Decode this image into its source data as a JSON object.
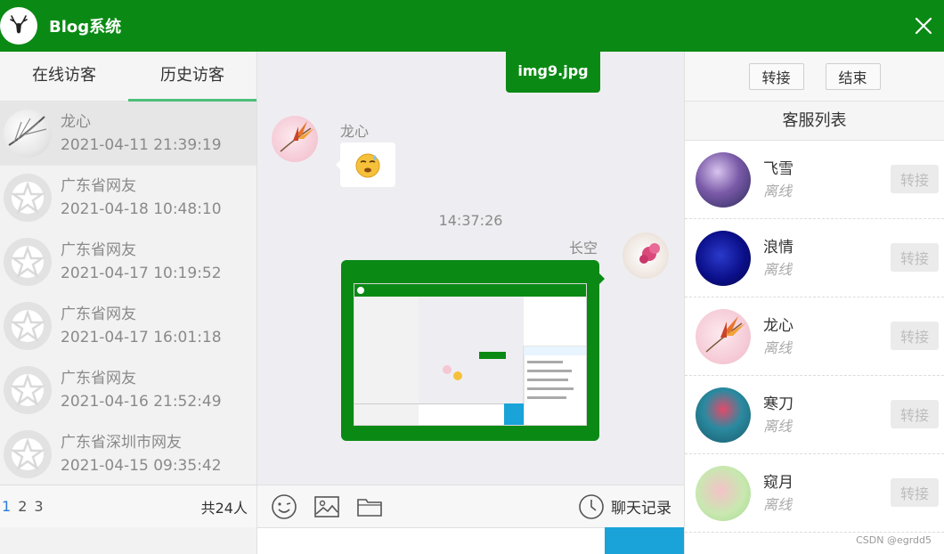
{
  "app": {
    "title": "Blog系统"
  },
  "left_panel": {
    "tabs": [
      {
        "label": "在线访客",
        "active": false
      },
      {
        "label": "历史访客",
        "active": true
      }
    ],
    "visitors": [
      {
        "name": "龙心",
        "time": "2021-04-11 21:39:19",
        "avatar": "feather-avatar",
        "selected": true
      },
      {
        "name": "广东省网友",
        "time": "2021-04-18 10:48:10",
        "avatar": "guest-avatar"
      },
      {
        "name": "广东省网友",
        "time": "2021-04-17 10:19:52",
        "avatar": "guest-avatar"
      },
      {
        "name": "广东省网友",
        "time": "2021-04-17 16:01:18",
        "avatar": "guest-avatar"
      },
      {
        "name": "广东省网友",
        "time": "2021-04-16 21:52:49",
        "avatar": "guest-avatar"
      },
      {
        "name": "广东省深圳市网友",
        "time": "2021-04-15 09:35:42",
        "avatar": "guest-avatar"
      }
    ],
    "pager": {
      "pages": [
        "1",
        "2",
        "3"
      ],
      "current": "1",
      "total": "共24人"
    }
  },
  "chat": {
    "file_tag": "img9.jpg",
    "messages": [
      {
        "sender": "龙心",
        "side": "left",
        "content": "emoji-sweat"
      },
      {
        "time": "14:37:26"
      },
      {
        "sender": "长空",
        "side": "right",
        "content": "image"
      }
    ],
    "toolbar": {
      "icons": [
        "emoji-icon",
        "image-icon",
        "folder-icon"
      ],
      "history_label": "聊天记录"
    }
  },
  "right_panel": {
    "transfer_label": "转接",
    "end_label": "结束",
    "list_title": "客服列表",
    "services": [
      {
        "name": "飞雪",
        "status": "离线",
        "action": "转接"
      },
      {
        "name": "浪情",
        "status": "离线",
        "action": "转接"
      },
      {
        "name": "龙心",
        "status": "离线",
        "action": "转接"
      },
      {
        "name": "寒刀",
        "status": "离线",
        "action": "转接"
      },
      {
        "name": "窥月",
        "status": "离线",
        "action": "转接"
      }
    ]
  },
  "watermark": "CSDN @egrdd5",
  "colors": {
    "brand_green": "#0a8a14",
    "tab_underline": "#4cbf7a",
    "send_blue": "#19a3d9",
    "page_link": "#2b7bd6"
  }
}
